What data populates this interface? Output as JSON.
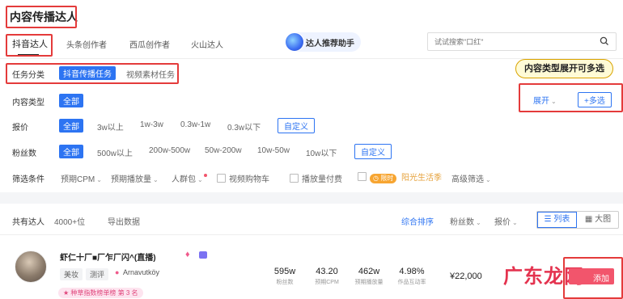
{
  "page_title": "内容传播达人",
  "platform_tabs": [
    "抖音达人",
    "头条创作者",
    "西瓜创作者",
    "火山达人"
  ],
  "assistant_label": "达人推荐助手",
  "search": {
    "placeholder": "试试搜索\"口红\""
  },
  "task": {
    "label": "任务分类",
    "options": [
      "抖音传播任务",
      "视频素材任务"
    ]
  },
  "callout": "内容类型展开可多选",
  "content_type": {
    "label": "内容类型",
    "selected": "全部",
    "expand": "展开",
    "multi": "+多选"
  },
  "price": {
    "label": "报价",
    "options": [
      "全部",
      "3w以上",
      "1w-3w",
      "0.3w-1w",
      "0.3w以下"
    ],
    "custom": "自定义"
  },
  "fans": {
    "label": "粉丝数",
    "options": [
      "全部",
      "500w以上",
      "200w-500w",
      "50w-200w",
      "10w-50w",
      "10w以下"
    ],
    "custom": "自定义"
  },
  "filter": {
    "label": "筛选条件",
    "items": [
      "预期CPM",
      "预期播放量",
      "人群包"
    ],
    "checks": [
      "视频购物车",
      "播放量付费"
    ],
    "promo_badge": "限时",
    "promo_text": "阳光生活季",
    "advanced": "高级筛选"
  },
  "results": {
    "label": "共有达人",
    "count": "4000+位",
    "export": "导出数据"
  },
  "sort": {
    "options": [
      "综合排序",
      "粉丝数",
      "报价"
    ]
  },
  "view": {
    "list": "列表",
    "grid": "大图"
  },
  "creator": {
    "name": "虾仁十厂■厂乍厂闪^(直播)",
    "tags": [
      "美妆",
      "测评"
    ],
    "handle": "Arnavutköy",
    "rank": "种草指数榜单榜 第 3 名",
    "stats": [
      {
        "value": "595w",
        "label": "粉丝数"
      },
      {
        "value": "43.20",
        "label": "预期CPM"
      },
      {
        "value": "462w",
        "label": "预期播放量"
      },
      {
        "value": "4.98%",
        "label": "作品互动率"
      }
    ],
    "price": "¥22,000",
    "add_label": "添加"
  },
  "watermark": "广东龙网",
  "colors": {
    "accent": "#2d74f2",
    "highlight": "#e43b3b",
    "callout_bg": "#fffbd6",
    "add_btn": "#f2556c"
  }
}
